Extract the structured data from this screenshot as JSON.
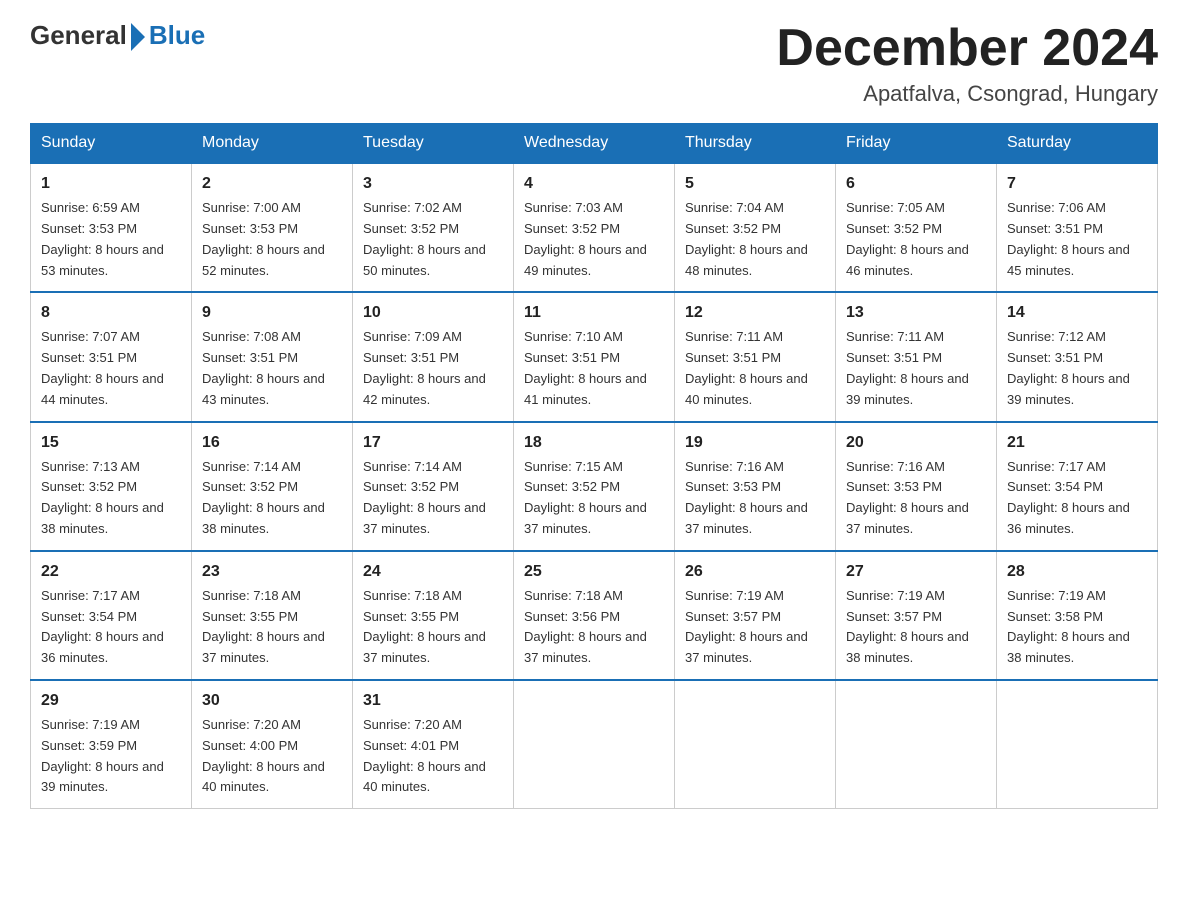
{
  "header": {
    "logo_general": "General",
    "logo_blue": "Blue",
    "month_title": "December 2024",
    "location": "Apatfalva, Csongrad, Hungary"
  },
  "days_of_week": [
    "Sunday",
    "Monday",
    "Tuesday",
    "Wednesday",
    "Thursday",
    "Friday",
    "Saturday"
  ],
  "weeks": [
    [
      {
        "day": "1",
        "sunrise": "6:59 AM",
        "sunset": "3:53 PM",
        "daylight": "8 hours and 53 minutes."
      },
      {
        "day": "2",
        "sunrise": "7:00 AM",
        "sunset": "3:53 PM",
        "daylight": "8 hours and 52 minutes."
      },
      {
        "day": "3",
        "sunrise": "7:02 AM",
        "sunset": "3:52 PM",
        "daylight": "8 hours and 50 minutes."
      },
      {
        "day": "4",
        "sunrise": "7:03 AM",
        "sunset": "3:52 PM",
        "daylight": "8 hours and 49 minutes."
      },
      {
        "day": "5",
        "sunrise": "7:04 AM",
        "sunset": "3:52 PM",
        "daylight": "8 hours and 48 minutes."
      },
      {
        "day": "6",
        "sunrise": "7:05 AM",
        "sunset": "3:52 PM",
        "daylight": "8 hours and 46 minutes."
      },
      {
        "day": "7",
        "sunrise": "7:06 AM",
        "sunset": "3:51 PM",
        "daylight": "8 hours and 45 minutes."
      }
    ],
    [
      {
        "day": "8",
        "sunrise": "7:07 AM",
        "sunset": "3:51 PM",
        "daylight": "8 hours and 44 minutes."
      },
      {
        "day": "9",
        "sunrise": "7:08 AM",
        "sunset": "3:51 PM",
        "daylight": "8 hours and 43 minutes."
      },
      {
        "day": "10",
        "sunrise": "7:09 AM",
        "sunset": "3:51 PM",
        "daylight": "8 hours and 42 minutes."
      },
      {
        "day": "11",
        "sunrise": "7:10 AM",
        "sunset": "3:51 PM",
        "daylight": "8 hours and 41 minutes."
      },
      {
        "day": "12",
        "sunrise": "7:11 AM",
        "sunset": "3:51 PM",
        "daylight": "8 hours and 40 minutes."
      },
      {
        "day": "13",
        "sunrise": "7:11 AM",
        "sunset": "3:51 PM",
        "daylight": "8 hours and 39 minutes."
      },
      {
        "day": "14",
        "sunrise": "7:12 AM",
        "sunset": "3:51 PM",
        "daylight": "8 hours and 39 minutes."
      }
    ],
    [
      {
        "day": "15",
        "sunrise": "7:13 AM",
        "sunset": "3:52 PM",
        "daylight": "8 hours and 38 minutes."
      },
      {
        "day": "16",
        "sunrise": "7:14 AM",
        "sunset": "3:52 PM",
        "daylight": "8 hours and 38 minutes."
      },
      {
        "day": "17",
        "sunrise": "7:14 AM",
        "sunset": "3:52 PM",
        "daylight": "8 hours and 37 minutes."
      },
      {
        "day": "18",
        "sunrise": "7:15 AM",
        "sunset": "3:52 PM",
        "daylight": "8 hours and 37 minutes."
      },
      {
        "day": "19",
        "sunrise": "7:16 AM",
        "sunset": "3:53 PM",
        "daylight": "8 hours and 37 minutes."
      },
      {
        "day": "20",
        "sunrise": "7:16 AM",
        "sunset": "3:53 PM",
        "daylight": "8 hours and 37 minutes."
      },
      {
        "day": "21",
        "sunrise": "7:17 AM",
        "sunset": "3:54 PM",
        "daylight": "8 hours and 36 minutes."
      }
    ],
    [
      {
        "day": "22",
        "sunrise": "7:17 AM",
        "sunset": "3:54 PM",
        "daylight": "8 hours and 36 minutes."
      },
      {
        "day": "23",
        "sunrise": "7:18 AM",
        "sunset": "3:55 PM",
        "daylight": "8 hours and 37 minutes."
      },
      {
        "day": "24",
        "sunrise": "7:18 AM",
        "sunset": "3:55 PM",
        "daylight": "8 hours and 37 minutes."
      },
      {
        "day": "25",
        "sunrise": "7:18 AM",
        "sunset": "3:56 PM",
        "daylight": "8 hours and 37 minutes."
      },
      {
        "day": "26",
        "sunrise": "7:19 AM",
        "sunset": "3:57 PM",
        "daylight": "8 hours and 37 minutes."
      },
      {
        "day": "27",
        "sunrise": "7:19 AM",
        "sunset": "3:57 PM",
        "daylight": "8 hours and 38 minutes."
      },
      {
        "day": "28",
        "sunrise": "7:19 AM",
        "sunset": "3:58 PM",
        "daylight": "8 hours and 38 minutes."
      }
    ],
    [
      {
        "day": "29",
        "sunrise": "7:19 AM",
        "sunset": "3:59 PM",
        "daylight": "8 hours and 39 minutes."
      },
      {
        "day": "30",
        "sunrise": "7:20 AM",
        "sunset": "4:00 PM",
        "daylight": "8 hours and 40 minutes."
      },
      {
        "day": "31",
        "sunrise": "7:20 AM",
        "sunset": "4:01 PM",
        "daylight": "8 hours and 40 minutes."
      },
      null,
      null,
      null,
      null
    ]
  ]
}
